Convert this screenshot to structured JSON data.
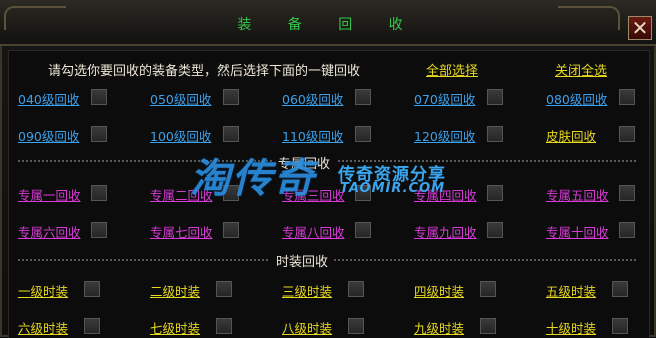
{
  "window": {
    "title": "装 备 回 收",
    "close_glyph": "✕"
  },
  "instruction": "请勾选你要回收的装备类型，然后选择下面的一键回收",
  "select_all_label": "全部选择",
  "deselect_all_label": "关闭全选",
  "level_items": [
    {
      "label": "040级回收"
    },
    {
      "label": "050级回收"
    },
    {
      "label": "060级回收"
    },
    {
      "label": "070级回收"
    },
    {
      "label": "080级回收"
    },
    {
      "label": "090级回收"
    },
    {
      "label": "100级回收"
    },
    {
      "label": "110级回收"
    },
    {
      "label": "120级回收"
    },
    {
      "label": "皮肤回收"
    }
  ],
  "exclusive_section_label": "专属回收",
  "exclusive_items": [
    {
      "label": "专属一回收"
    },
    {
      "label": "专属二回收"
    },
    {
      "label": "专属三回收"
    },
    {
      "label": "专属四回收"
    },
    {
      "label": "专属五回收"
    },
    {
      "label": "专属六回收"
    },
    {
      "label": "专属七回收"
    },
    {
      "label": "专属八回收"
    },
    {
      "label": "专属九回收"
    },
    {
      "label": "专属十回收"
    }
  ],
  "fashion_section_label": "时装回收",
  "fashion_items": [
    {
      "label": "一级时装"
    },
    {
      "label": "二级时装"
    },
    {
      "label": "三级时装"
    },
    {
      "label": "四级时装"
    },
    {
      "label": "五级时装"
    },
    {
      "label": "六级时装"
    },
    {
      "label": "七级时装"
    },
    {
      "label": "八级时装"
    },
    {
      "label": "九级时装"
    },
    {
      "label": "十级时装"
    }
  ],
  "watermark": {
    "brand": "淘传奇",
    "tagline": "传奇资源分享",
    "url": "TAOMIR.COM"
  },
  "colors": {
    "title": "#34c94a",
    "level_link": "#3da0ea",
    "skin_link": "#e8d820",
    "exclusive_link": "#d83ad8",
    "fashion_link": "#e8d820",
    "header_link": "#e8d820"
  }
}
